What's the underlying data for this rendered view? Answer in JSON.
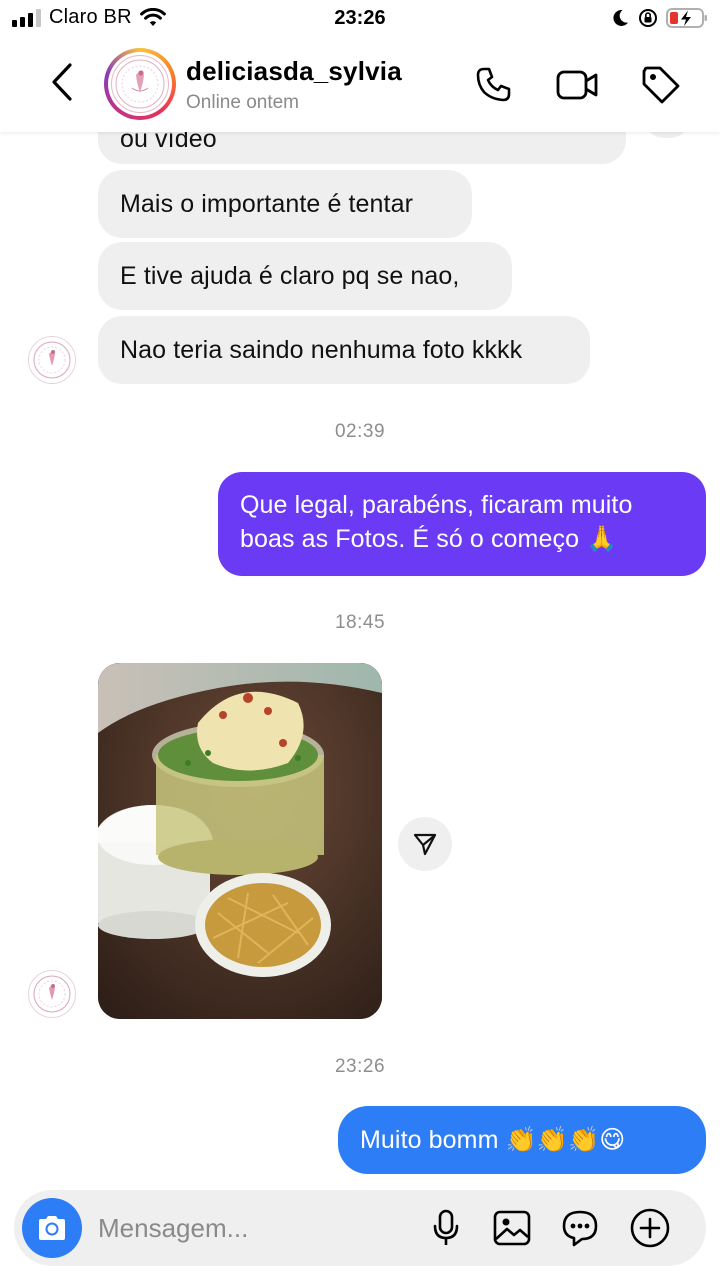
{
  "status_bar": {
    "carrier": "Claro BR",
    "time": "23:26"
  },
  "header": {
    "contact_name": "deliciasda_sylvia",
    "contact_status": "Online ontem",
    "icons": [
      "back-chevron-icon",
      "phone-icon",
      "video-camera-icon",
      "tag-icon"
    ]
  },
  "messages": {
    "partial_top": "ou vídeo",
    "m1": "Mais o importante é tentar",
    "m2": "E tive ajuda é claro pq se nao,",
    "m3": "Nao teria saindo nenhuma foto kkkk",
    "time1": "02:39",
    "out1": "Que legal, parabéns, ficaram muito boas as Fotos. É só o começo 🙏",
    "time2": "18:45",
    "time3": "23:26",
    "out2": "Muito bomm 👏👏👏😋"
  },
  "composer": {
    "placeholder": "Mensagem...",
    "icons": [
      "camera-icon",
      "microphone-icon",
      "gallery-icon",
      "sticker-chat-icon",
      "add-icon"
    ]
  },
  "colors": {
    "outgoing_purple": "#6b3af5",
    "outgoing_blue": "#2d7df6",
    "incoming_gray": "#efefef"
  }
}
